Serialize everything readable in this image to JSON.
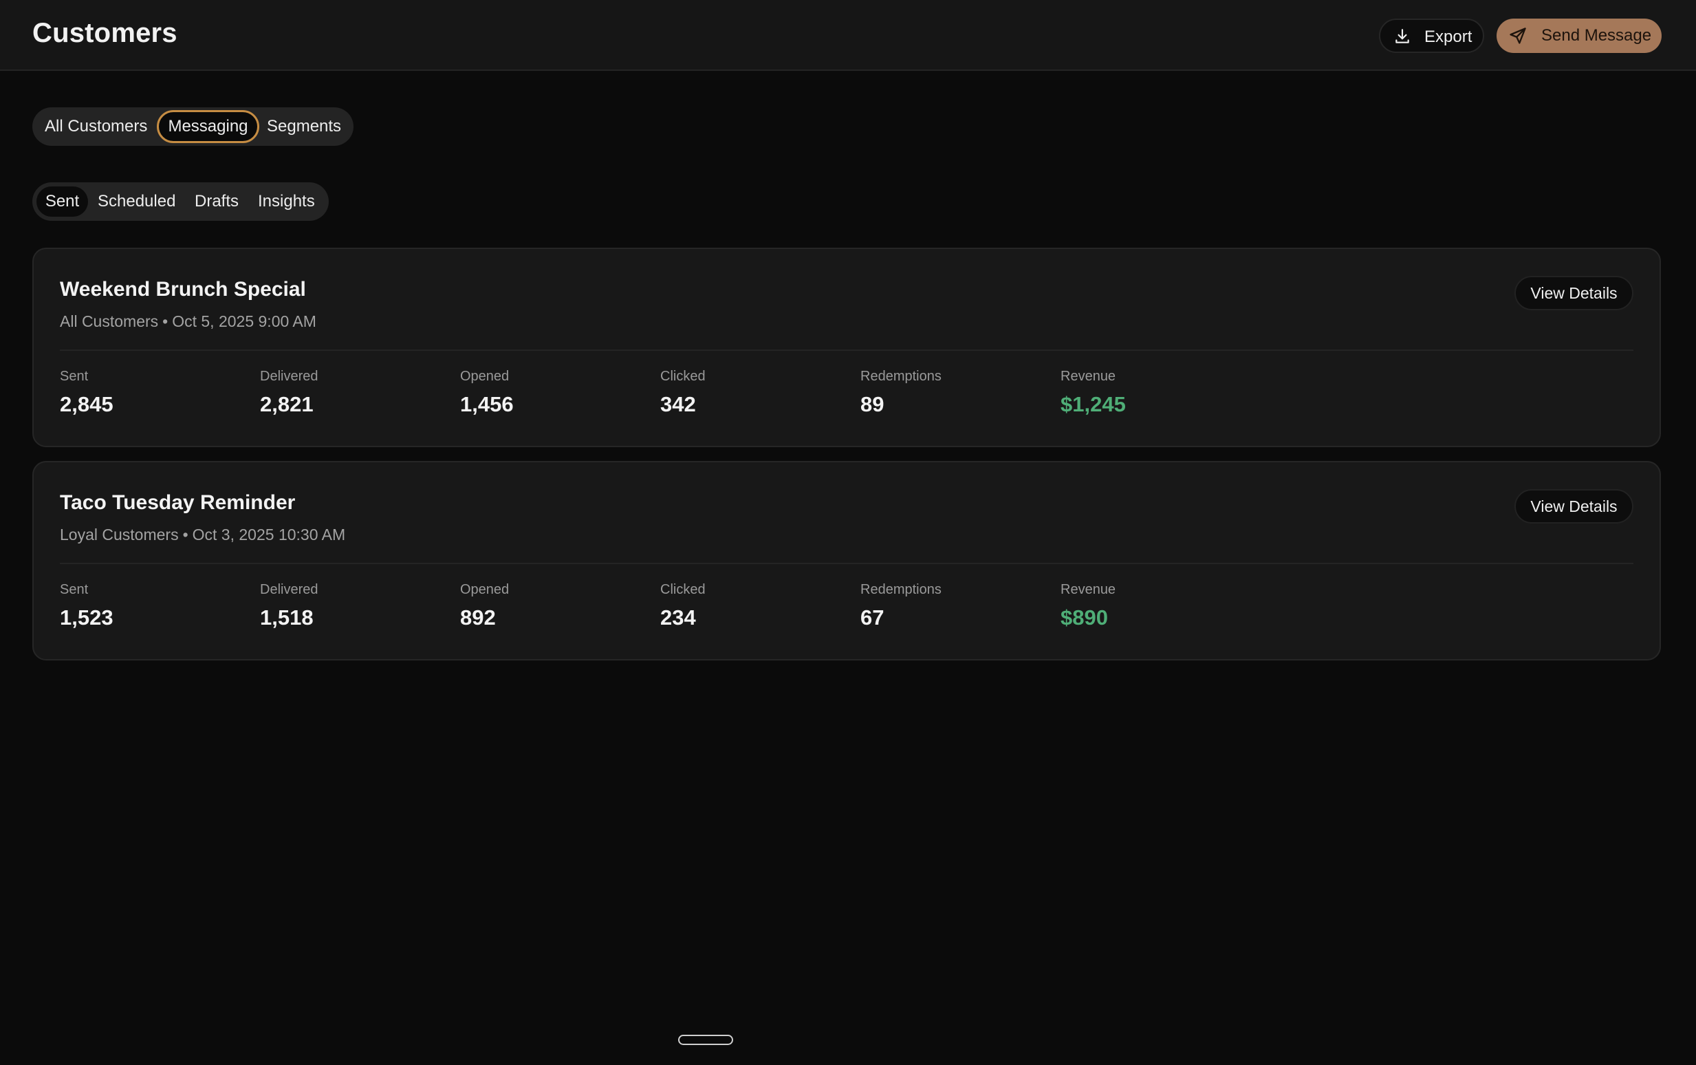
{
  "header": {
    "title": "Customers",
    "export_label": "Export",
    "send_label": "Send Message"
  },
  "primary_tabs": [
    "All Customers",
    "Messaging",
    "Segments"
  ],
  "primary_tabs_selected": "Messaging",
  "secondary_tabs": [
    "Sent",
    "Scheduled",
    "Drafts",
    "Insights"
  ],
  "secondary_tabs_selected": "Sent",
  "campaigns": [
    {
      "title": "Weekend Brunch Special",
      "audience": "All Customers",
      "separator": "•",
      "datetime": "Oct 5, 2025 9:00 AM",
      "action_label": "View Details",
      "stats": [
        {
          "label": "Sent",
          "value": "2,845"
        },
        {
          "label": "Delivered",
          "value": "2,821"
        },
        {
          "label": "Opened",
          "value": "1,456"
        },
        {
          "label": "Clicked",
          "value": "342"
        },
        {
          "label": "Redemptions",
          "value": "89"
        },
        {
          "label": "Revenue",
          "value": "$1,245"
        }
      ]
    },
    {
      "title": "Taco Tuesday Reminder",
      "audience": "Loyal Customers",
      "separator": "•",
      "datetime": "Oct 3, 2025 10:30 AM",
      "action_label": "View Details",
      "stats": [
        {
          "label": "Sent",
          "value": "1,523"
        },
        {
          "label": "Delivered",
          "value": "1,518"
        },
        {
          "label": "Opened",
          "value": "892"
        },
        {
          "label": "Clicked",
          "value": "234"
        },
        {
          "label": "Redemptions",
          "value": "67"
        },
        {
          "label": "Revenue",
          "value": "$890"
        }
      ]
    }
  ],
  "icons": {
    "export": "download-icon",
    "send": "send-icon"
  },
  "colors": {
    "accent": "#a57859",
    "active_tab_ring": "#c68d43",
    "revenue": "#4fae77",
    "background": "#0b0b0b",
    "card": "#181818"
  }
}
